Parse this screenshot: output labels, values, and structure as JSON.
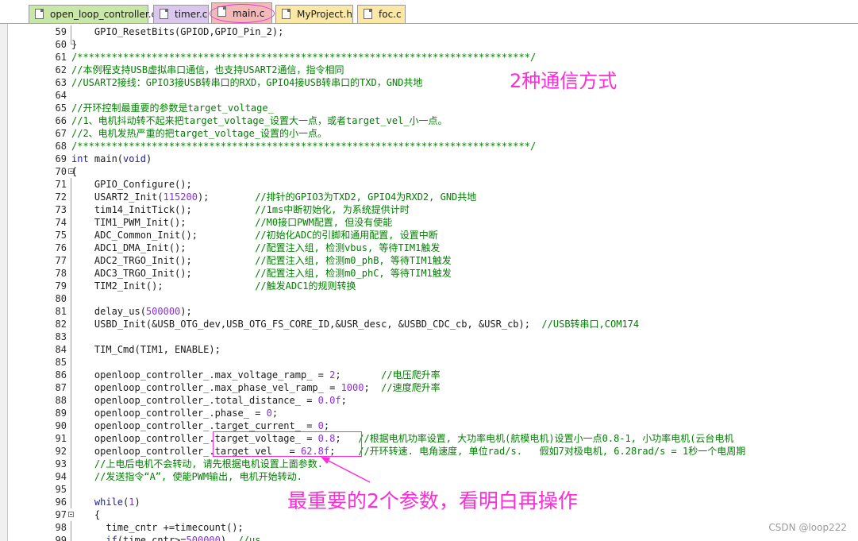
{
  "tabs": [
    {
      "label": "open_loop_controller.c",
      "color": "#c9e7a7",
      "active": false
    },
    {
      "label": "timer.c",
      "color": "#d9c8ec",
      "active": false
    },
    {
      "label": "main.c",
      "color": "#f4b8b8",
      "active": true
    },
    {
      "label": "MyProject.h",
      "color": "#fbe8a6",
      "active": false
    },
    {
      "label": "foc.c",
      "color": "#fbe8a6",
      "active": false
    }
  ],
  "lines": [
    {
      "n": "59",
      "code": "    GPIO_ResetBits(GPIOD,GPIO_Pin_2);"
    },
    {
      "n": "60",
      "code": "}"
    },
    {
      "n": "61",
      "code": "/*******************************************************************************/"
    },
    {
      "n": "62",
      "code": "//本例程支持USB虚拟串口通信，也支持USART2通信，指令相同"
    },
    {
      "n": "63",
      "code": "//USART2接线：GPIO3接USB转串口的RXD，GPIO4接USB转串口的TXD，GND共地"
    },
    {
      "n": "64",
      "code": ""
    },
    {
      "n": "65",
      "code": "//开环控制最重要的参数是target_voltage_"
    },
    {
      "n": "66",
      "code": "//1、电机抖动转不起来把target_voltage_设置大一点，或者target_vel_小一点。"
    },
    {
      "n": "67",
      "code": "//2、电机发热严重的把target_voltage_设置的小一点。"
    },
    {
      "n": "68",
      "code": "/*******************************************************************************/"
    },
    {
      "n": "69",
      "code": "int main(void)"
    },
    {
      "n": "70",
      "code": "{"
    },
    {
      "n": "71",
      "code": "    GPIO_Configure();"
    },
    {
      "n": "72",
      "code": "    USART2_Init(115200);        //排针的GPIO3为TXD2, GPIO4为RXD2, GND共地"
    },
    {
      "n": "73",
      "code": "    tim14_InitTick();           //1ms中断初始化, 为系统提供计时"
    },
    {
      "n": "74",
      "code": "    TIM1_PWM_Init();            //M0接口PWM配置, 但没有使能"
    },
    {
      "n": "75",
      "code": "    ADC_Common_Init();          //初始化ADC的引脚和通用配置, 设置中断"
    },
    {
      "n": "76",
      "code": "    ADC1_DMA_Init();            //配置注入组, 检测vbus, 等待TIM1触发"
    },
    {
      "n": "77",
      "code": "    ADC2_TRGO_Init();           //配置注入组, 检测m0_phB, 等待TIM1触发"
    },
    {
      "n": "78",
      "code": "    ADC3_TRGO_Init();           //配置注入组, 检测m0_phC, 等待TIM1触发"
    },
    {
      "n": "79",
      "code": "    TIM2_Init();                //触发ADC1的规则转换"
    },
    {
      "n": "80",
      "code": ""
    },
    {
      "n": "81",
      "code": "    delay_us(500000);"
    },
    {
      "n": "82",
      "code": "    USBD_Init(&USB_OTG_dev,USB_OTG_FS_CORE_ID,&USR_desc, &USBD_CDC_cb, &USR_cb);  //USB转串口,COM174"
    },
    {
      "n": "83",
      "code": ""
    },
    {
      "n": "84",
      "code": "    TIM_Cmd(TIM1, ENABLE);"
    },
    {
      "n": "85",
      "code": ""
    },
    {
      "n": "86",
      "code": "    openloop_controller_.max_voltage_ramp_ = 2;       //电压爬升率"
    },
    {
      "n": "87",
      "code": "    openloop_controller_.max_phase_vel_ramp_ = 1000;  //速度爬升率"
    },
    {
      "n": "88",
      "code": "    openloop_controller_.total_distance_ = 0.0f;"
    },
    {
      "n": "89",
      "code": "    openloop_controller_.phase_ = 0;"
    },
    {
      "n": "90",
      "code": "    openloop_controller_.target_current_ = 0;"
    },
    {
      "n": "91",
      "code": "    openloop_controller_.target_voltage_ = 0.8;   //根据电机功率设置, 大功率电机(航模电机)设置小一点0.8-1, 小功率电机(云台电机"
    },
    {
      "n": "92",
      "code": "    openloop_controller_.target_vel_  = 62.8f;    //开环转速. 电角速度, 单位rad/s.   假如7对极电机, 6.28rad/s = 1秒一个电周期"
    },
    {
      "n": "93",
      "code": "    //上电后电机不会转动, 请先根据电机设置上面参数."
    },
    {
      "n": "94",
      "code": "    //发送指令“A”, 使能PWM输出, 电机开始转动."
    },
    {
      "n": "95",
      "code": ""
    },
    {
      "n": "96",
      "code": "    while(1)"
    },
    {
      "n": "97",
      "code": "    {"
    },
    {
      "n": "98",
      "code": "      time_cntr +=timecount();"
    },
    {
      "n": "99",
      "code": "      if(time_cntr>=500000)  //us"
    }
  ],
  "annotations": {
    "comm_modes": "2种通信方式",
    "key_params": "最重要的2个参数，看明白再操作"
  },
  "watermark": "CSDN @loop222",
  "colors": {
    "annotation": "#ff2bd8",
    "comment": "#008000",
    "number": "#8a2be2",
    "keyword": "#1a1aa6"
  }
}
